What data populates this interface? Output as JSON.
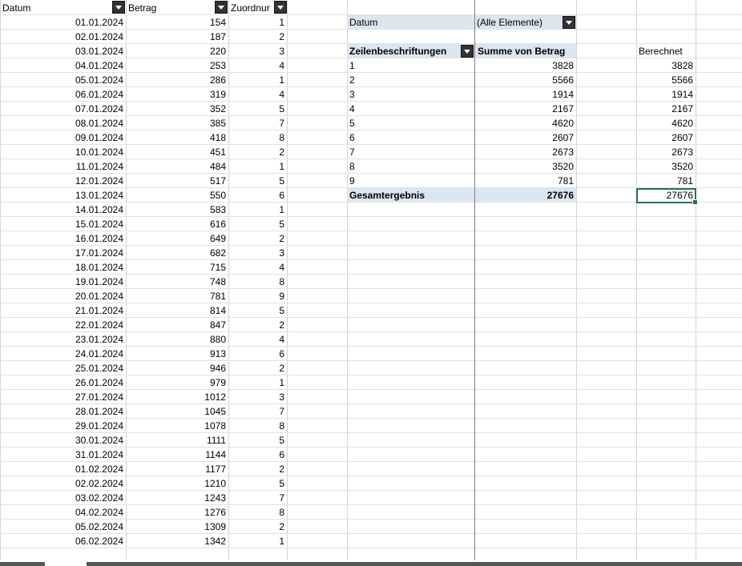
{
  "table": {
    "headers": [
      "Datum",
      "Betrag",
      "Zuordnur"
    ],
    "rows": [
      [
        "01.01.2024",
        "154",
        "1"
      ],
      [
        "02.01.2024",
        "187",
        "2"
      ],
      [
        "03.01.2024",
        "220",
        "3"
      ],
      [
        "04.01.2024",
        "253",
        "4"
      ],
      [
        "05.01.2024",
        "286",
        "1"
      ],
      [
        "06.01.2024",
        "319",
        "4"
      ],
      [
        "07.01.2024",
        "352",
        "5"
      ],
      [
        "08.01.2024",
        "385",
        "7"
      ],
      [
        "09.01.2024",
        "418",
        "8"
      ],
      [
        "10.01.2024",
        "451",
        "2"
      ],
      [
        "11.01.2024",
        "484",
        "1"
      ],
      [
        "12.01.2024",
        "517",
        "5"
      ],
      [
        "13.01.2024",
        "550",
        "6"
      ],
      [
        "14.01.2024",
        "583",
        "1"
      ],
      [
        "15.01.2024",
        "616",
        "5"
      ],
      [
        "16.01.2024",
        "649",
        "2"
      ],
      [
        "17.01.2024",
        "682",
        "3"
      ],
      [
        "18.01.2024",
        "715",
        "4"
      ],
      [
        "19.01.2024",
        "748",
        "8"
      ],
      [
        "20.01.2024",
        "781",
        "9"
      ],
      [
        "21.01.2024",
        "814",
        "5"
      ],
      [
        "22.01.2024",
        "847",
        "2"
      ],
      [
        "23.01.2024",
        "880",
        "4"
      ],
      [
        "24.01.2024",
        "913",
        "6"
      ],
      [
        "25.01.2024",
        "946",
        "2"
      ],
      [
        "26.01.2024",
        "979",
        "1"
      ],
      [
        "27.01.2024",
        "1012",
        "3"
      ],
      [
        "28.01.2024",
        "1045",
        "7"
      ],
      [
        "29.01.2024",
        "1078",
        "8"
      ],
      [
        "30.01.2024",
        "1111",
        "5"
      ],
      [
        "31.01.2024",
        "1144",
        "6"
      ],
      [
        "01.02.2024",
        "1177",
        "2"
      ],
      [
        "02.02.2024",
        "1210",
        "5"
      ],
      [
        "03.02.2024",
        "1243",
        "7"
      ],
      [
        "04.02.2024",
        "1276",
        "8"
      ],
      [
        "05.02.2024",
        "1309",
        "2"
      ],
      [
        "06.02.2024",
        "1342",
        "1"
      ]
    ]
  },
  "pivot": {
    "filter_label": "Datum",
    "filter_value": "(Alle Elemente)",
    "row_header": "Zeilenbeschriftungen",
    "value_header": "Summe von Betrag",
    "rows": [
      [
        "1",
        "3828"
      ],
      [
        "2",
        "5566"
      ],
      [
        "3",
        "1914"
      ],
      [
        "4",
        "2167"
      ],
      [
        "5",
        "4620"
      ],
      [
        "6",
        "2607"
      ],
      [
        "7",
        "2673"
      ],
      [
        "8",
        "3520"
      ],
      [
        "9",
        "781"
      ]
    ],
    "total_label": "Gesamtergebnis",
    "total_value": "27676"
  },
  "computed": {
    "header": "Berechnet",
    "values": [
      "3828",
      "5566",
      "1914",
      "2167",
      "4620",
      "2607",
      "2673",
      "3520",
      "781"
    ],
    "total": "27676"
  },
  "colors": {
    "pivot_header_band": "#dce6f1",
    "selection": "#217346",
    "filter_button": "#333333"
  }
}
